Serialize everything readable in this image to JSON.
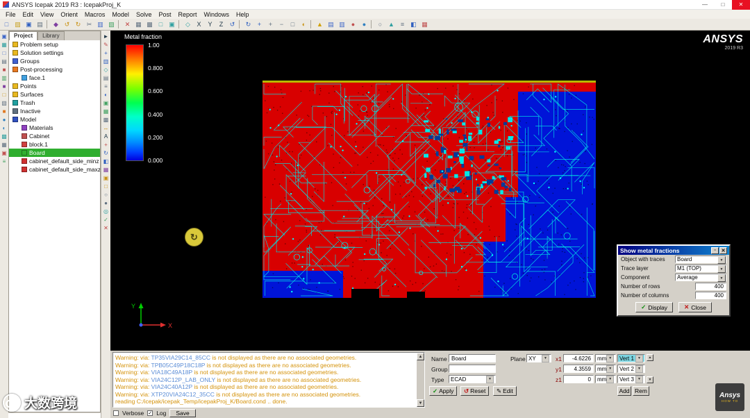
{
  "window": {
    "title": "ANSYS Icepak 2019 R3 : IcepakProj_K",
    "minimize": "—",
    "maximize": "□",
    "close": "✕"
  },
  "menu": {
    "items": [
      "File",
      "Edit",
      "View",
      "Orient",
      "Macros",
      "Model",
      "Solve",
      "Post",
      "Report",
      "Windows",
      "Help"
    ]
  },
  "toolbar": {
    "icons": [
      {
        "n": "new-project",
        "g": "□",
        "c": "#4068c8"
      },
      {
        "n": "open-project",
        "g": "▨",
        "c": "#c8a020"
      },
      {
        "n": "save-project",
        "g": "▣",
        "c": "#3060c0"
      },
      {
        "n": "print",
        "g": "▤",
        "c": "#607080"
      },
      {
        "n": "screenshot",
        "g": "◆",
        "c": "#8040a0"
      },
      {
        "n": "undo",
        "g": "↺",
        "c": "#c89010"
      },
      {
        "n": "redo",
        "g": "↻",
        "c": "#c89010"
      },
      {
        "n": "cut",
        "g": "✂",
        "c": "#607080"
      },
      {
        "n": "copy",
        "g": "▥",
        "c": "#4068c8"
      },
      {
        "n": "paste",
        "g": "▧",
        "c": "#40a060"
      },
      {
        "n": "delete",
        "g": "✕",
        "c": "#c04040"
      },
      {
        "n": "create-grid",
        "g": "▦",
        "c": "#607080"
      },
      {
        "n": "summary-table",
        "g": "▩",
        "c": "#607080"
      },
      {
        "n": "view-front",
        "g": "□",
        "c": "#30a0a0"
      },
      {
        "n": "view-top",
        "g": "▣",
        "c": "#30a0a0"
      },
      {
        "n": "view-iso",
        "g": "◇",
        "c": "#30a0a0"
      },
      {
        "n": "axis-x",
        "g": "X",
        "c": "#203848"
      },
      {
        "n": "axis-y",
        "g": "Y",
        "c": "#203848"
      },
      {
        "n": "axis-z",
        "g": "Z",
        "c": "#203848"
      },
      {
        "n": "rotate-ccw",
        "g": "↺",
        "c": "#3060c0"
      },
      {
        "n": "rotate-cw",
        "g": "↻",
        "c": "#3060c0"
      },
      {
        "n": "pan-view",
        "g": "+",
        "c": "#3060c0"
      },
      {
        "n": "zoom-in",
        "g": "+",
        "c": "#607080"
      },
      {
        "n": "zoom-out",
        "g": "−",
        "c": "#607080"
      },
      {
        "n": "fit-window",
        "g": "□",
        "c": "#607080"
      },
      {
        "n": "orient-tool",
        "g": "◐",
        "c": "#c89010"
      },
      {
        "n": "warning-check",
        "g": "▲",
        "c": "#d0a000"
      },
      {
        "n": "object-list",
        "g": "▤",
        "c": "#4068c8"
      },
      {
        "n": "display-options",
        "g": "▥",
        "c": "#4068c8"
      },
      {
        "n": "color-settings",
        "g": "●",
        "c": "#c05050"
      },
      {
        "n": "world-view",
        "g": "●",
        "c": "#3080c0"
      },
      {
        "n": "probe-point",
        "g": "○",
        "c": "#607080"
      },
      {
        "n": "measure",
        "g": "▲",
        "c": "#30a0a0"
      },
      {
        "n": "align",
        "g": "≡",
        "c": "#607080"
      },
      {
        "n": "cut-plane",
        "g": "◧",
        "c": "#3060c0"
      },
      {
        "n": "report-tool",
        "g": "▦",
        "c": "#c05050"
      }
    ]
  },
  "strip1": {
    "icons": [
      {
        "n": "create-assembly",
        "g": "▣",
        "c": "#4068c8"
      },
      {
        "n": "create-heat-exchanger",
        "g": "▦",
        "c": "#30a0a0"
      },
      {
        "n": "create-opening",
        "g": "□",
        "c": "#4068c8"
      },
      {
        "n": "create-grille",
        "g": "▤",
        "c": "#607080"
      },
      {
        "n": "create-source",
        "g": "■",
        "c": "#c05050"
      },
      {
        "n": "create-pcb",
        "g": "▥",
        "c": "#40a060"
      },
      {
        "n": "create-plate",
        "g": "■",
        "c": "#8040a0"
      },
      {
        "n": "create-enclosure",
        "g": "□",
        "c": "#c89010"
      },
      {
        "n": "create-wall",
        "g": "▧",
        "c": "#607080"
      },
      {
        "n": "create-block",
        "g": "■",
        "c": "#e07820"
      },
      {
        "n": "create-fan",
        "g": "●",
        "c": "#3080c0"
      },
      {
        "n": "create-blower",
        "g": "◐",
        "c": "#3080c0"
      },
      {
        "n": "create-resistance",
        "g": "▩",
        "c": "#30a0a0"
      },
      {
        "n": "create-heatsink",
        "g": "▦",
        "c": "#607080"
      },
      {
        "n": "create-package",
        "g": "▣",
        "c": "#c05050"
      },
      {
        "n": "create-trace",
        "g": "≡",
        "c": "#40a060"
      }
    ]
  },
  "strip2": {
    "icons": [
      {
        "n": "select-mode",
        "g": "►",
        "c": "#203848"
      },
      {
        "n": "edit-object",
        "g": "✎",
        "c": "#c05050"
      },
      {
        "n": "move-object",
        "g": "+",
        "c": "#3060c0"
      },
      {
        "n": "copy-object",
        "g": "▥",
        "c": "#3060c0"
      },
      {
        "n": "scale-object",
        "g": "◇",
        "c": "#30a0a0"
      },
      {
        "n": "align-faces",
        "g": "▤",
        "c": "#607080"
      },
      {
        "n": "align-edges",
        "g": "≡",
        "c": "#607080"
      },
      {
        "n": "center-object",
        "g": "◐",
        "c": "#3060c0"
      },
      {
        "n": "match-faces",
        "g": "▣",
        "c": "#40a060"
      },
      {
        "n": "match-edges",
        "g": "▦",
        "c": "#40a060"
      },
      {
        "n": "snap-to-grid",
        "g": "▩",
        "c": "#607080"
      },
      {
        "n": "measure-distance",
        "g": "↔",
        "c": "#c89010"
      },
      {
        "n": "annotate-text",
        "g": "A",
        "c": "#203848"
      },
      {
        "n": "local-coords",
        "g": "+",
        "c": "#c05050"
      },
      {
        "n": "rotate-object",
        "g": "↻",
        "c": "#3060c0"
      },
      {
        "n": "mirror-object",
        "g": "◧",
        "c": "#3060c0"
      },
      {
        "n": "array-copy",
        "g": "▦",
        "c": "#8040a0"
      },
      {
        "n": "group-objects",
        "g": "▣",
        "c": "#c89010"
      },
      {
        "n": "ungroup-objects",
        "g": "□",
        "c": "#c89010"
      },
      {
        "n": "hide-object",
        "g": "○",
        "c": "#607080"
      },
      {
        "n": "show-object",
        "g": "●",
        "c": "#607080"
      },
      {
        "n": "zoom-selection",
        "g": "◎",
        "c": "#30a0a0"
      },
      {
        "n": "check-model",
        "g": "✓",
        "c": "#40a060"
      },
      {
        "n": "delete-object",
        "g": "✕",
        "c": "#c04040"
      }
    ]
  },
  "left_panel": {
    "tabs": [
      "Project",
      "Library"
    ],
    "tree": [
      {
        "label": "Problem setup",
        "indent": 0,
        "color": "#e8b820"
      },
      {
        "label": "Solution settings",
        "indent": 0,
        "color": "#e8b820"
      },
      {
        "label": "Groups",
        "indent": 0,
        "color": "#4060d0"
      },
      {
        "label": "Post-processing",
        "indent": 0,
        "color": "#e87820"
      },
      {
        "label": "face.1",
        "indent": 1,
        "color": "#40a0e0"
      },
      {
        "label": "Points",
        "indent": 0,
        "color": "#e8b820"
      },
      {
        "label": "Surfaces",
        "indent": 0,
        "color": "#e8b820"
      },
      {
        "label": "Trash",
        "indent": 0,
        "color": "#20a0a0"
      },
      {
        "label": "Inactive",
        "indent": 0,
        "color": "#607080"
      },
      {
        "label": "Model",
        "indent": 0,
        "color": "#3050c0"
      },
      {
        "label": "Materials",
        "indent": 1,
        "color": "#9040c0"
      },
      {
        "label": "Cabinet",
        "indent": 1,
        "color": "#c05050"
      },
      {
        "label": "block.1",
        "indent": 1,
        "color": "#d04040"
      },
      {
        "label": "Board",
        "indent": 1,
        "color": "#30b030",
        "selected": true
      },
      {
        "label": "cabinet_default_side_minz",
        "indent": 1,
        "color": "#d03030"
      },
      {
        "label": "cabinet_default_side_maxz",
        "indent": 1,
        "color": "#d03030"
      }
    ]
  },
  "viewport": {
    "legend": {
      "title": "Metal fraction",
      "ticks": [
        "1.00",
        "0.800",
        "0.600",
        "0.400",
        "0.200",
        "0.000"
      ]
    },
    "brand": {
      "name": "ANSYS",
      "version": "2019 R3"
    },
    "axes": {
      "x": "X",
      "y": "Y"
    },
    "cursor_glyph": "↻"
  },
  "dialog": {
    "title": "Show metal fractions",
    "rows": [
      {
        "label": "Object with traces",
        "value": "Board",
        "type": "select"
      },
      {
        "label": "Trace layer",
        "value": "M1 (TOP)",
        "type": "select"
      },
      {
        "label": "Component",
        "value": "Average",
        "type": "select"
      },
      {
        "label": "Number of rows",
        "value": "400",
        "type": "input"
      },
      {
        "label": "Number of columns",
        "value": "400",
        "type": "input"
      }
    ],
    "display_label": "Display",
    "close_label": "Close"
  },
  "console": {
    "messages": [
      {
        "pre": "Warning: via: ",
        "via": "TP35VIA29C14_85CC",
        "post": " is not displayed as there are no associated geometries."
      },
      {
        "pre": "Warning: via: ",
        "via": "TPB05C49P18C18P",
        "post": " is not displayed as there are no associated geometries."
      },
      {
        "pre": "Warning: via: ",
        "via": "VIA18C49A18P",
        "post": " is not displayed as there are no associated geometries."
      },
      {
        "pre": "Warning: via: ",
        "via": "VIA24C12P_LAB_ONLY",
        "post": " is not displayed as there are no associated geometries."
      },
      {
        "pre": "Warning: via: ",
        "via": "VIA24C40A12P",
        "post": " is not displayed as there are no associated geometries."
      },
      {
        "pre": "Warning: via: ",
        "via": "XTP20VIA24C12_35CC",
        "post": " is not displayed as there are no associated geometries."
      },
      {
        "pre": "reading C:/icepak/icepak_Temp/icepakProj_K/Board.cond .. done.",
        "via": "",
        "post": ""
      }
    ],
    "verbose_label": "Verbose",
    "log_label": "Log",
    "save_label": "Save"
  },
  "properties": {
    "name_label": "Name",
    "name_value": "Board",
    "group_label": "Group",
    "group_value": "",
    "type_label": "Type",
    "type_value": "ECAD",
    "plane_label": "Plane",
    "plane_value": "XY",
    "x1_label": "x1",
    "x1_value": "-4.6226",
    "y1_label": "y1",
    "y1_value": "4.3559",
    "z1_label": "z1",
    "z1_value": "0",
    "unit": "mm",
    "vert1": "Vert 1",
    "vert2": "Vert 2",
    "vert3": "Vert 3",
    "add_label": "Add",
    "rem_label": "Rem",
    "apply_label": "Apply",
    "reset_label": "Reset",
    "edit_label": "Edit"
  },
  "watermark": {
    "text": "大数跨境"
  },
  "badge": {
    "line1": "Ansys",
    "line2": "HOW TO"
  },
  "colors": {
    "board_copper": "#d80000",
    "board_substrate": "#0014d8",
    "board_trace": "#00e6e6",
    "board_edge": "#b8b800",
    "selected_tree": "#2fae2f",
    "warning_text": "#d4920a",
    "via_link": "#5b8dd6"
  }
}
